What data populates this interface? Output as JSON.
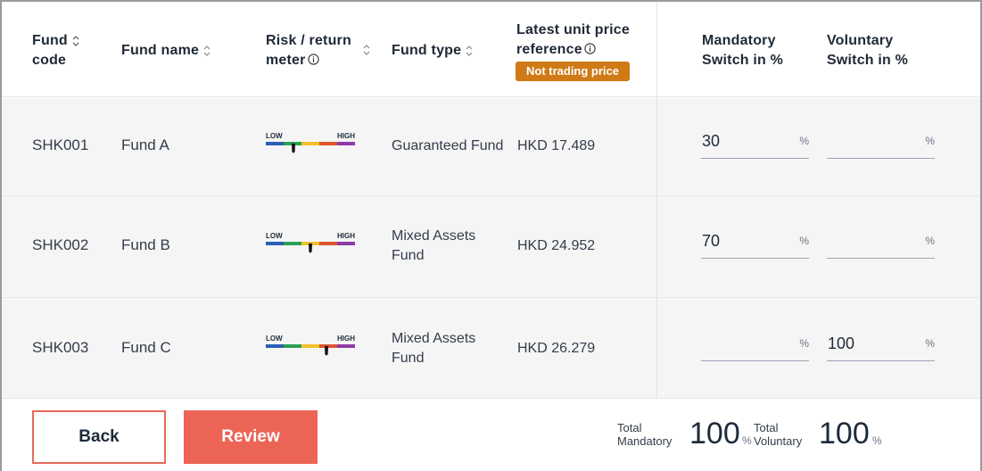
{
  "header": {
    "fund_code": [
      "Fund",
      "code"
    ],
    "fund_name": "Fund name",
    "risk_meter": [
      "Risk / return",
      "meter"
    ],
    "fund_type": "Fund type",
    "latest_price": [
      "Latest unit price",
      "reference"
    ],
    "not_trading_badge": "Not trading price",
    "mandatory": [
      "Mandatory",
      "Switch in %"
    ],
    "voluntary": [
      "Voluntary",
      "Switch in %"
    ]
  },
  "meter": {
    "low_label": "LOW",
    "high_label": "HIGH",
    "colors": [
      "#2b5fb4",
      "#2aa154",
      "#f0c22a",
      "#e0542c",
      "#8e3aa8"
    ]
  },
  "rows": [
    {
      "code": "SHK001",
      "name": "Fund A",
      "risk_level": 2,
      "fund_type": [
        "Guaranteed Fund"
      ],
      "price": "HKD 17.489",
      "mandatory": "30",
      "voluntary": "",
      "pct_sign": "%"
    },
    {
      "code": "SHK002",
      "name": "Fund B",
      "risk_level": 3,
      "fund_type": [
        "Mixed Assets",
        "Fund"
      ],
      "price": "HKD 24.952",
      "mandatory": "70",
      "voluntary": "",
      "pct_sign": "%"
    },
    {
      "code": "SHK003",
      "name": "Fund C",
      "risk_level": 4,
      "fund_type": [
        "Mixed Assets",
        "Fund"
      ],
      "price": "HKD 26.279",
      "mandatory": "",
      "voluntary": "100",
      "pct_sign": "%"
    }
  ],
  "footer": {
    "back_label": "Back",
    "review_label": "Review",
    "total_mandatory_label": [
      "Total",
      "Mandatory"
    ],
    "total_mandatory_value": "100",
    "total_voluntary_label": [
      "Total",
      "Voluntary"
    ],
    "total_voluntary_value": "100",
    "pct_sign": "%"
  },
  "colors": {
    "accent": "#ec6455",
    "badge": "#cf7a16",
    "row_bg": "#f5f5f5"
  }
}
